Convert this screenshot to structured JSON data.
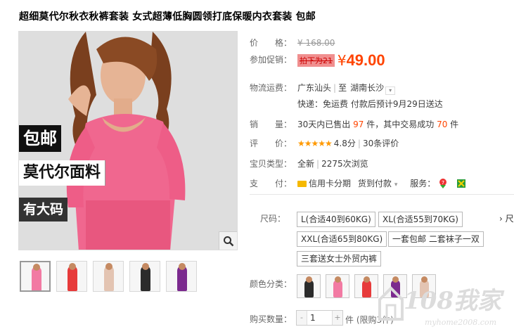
{
  "product": {
    "title": "超细莫代尔秋衣秋裤套装 女式超薄低胸圆领打底保暖内衣套装 包邮"
  },
  "gallery": {
    "promo_lines": [
      "包邮",
      "莫代尔面料",
      "有大码"
    ],
    "thumbnails": [
      {
        "color": "#f27aa3",
        "active": true
      },
      {
        "color": "#e73b3b",
        "active": false
      },
      {
        "color": "#e3c4b2",
        "active": false
      },
      {
        "color": "#2b2b2b",
        "active": false
      },
      {
        "color": "#7b2a8e",
        "active": false
      }
    ]
  },
  "price": {
    "label": "价　　格：",
    "original": "¥ 168.00",
    "promo_label": "参加促销：",
    "promo_tag": "拍下为21",
    "currency": "¥",
    "current": "49.00"
  },
  "shipping": {
    "label": "物流运费：",
    "from": "广东汕头",
    "to_prefix": "至",
    "to": "湖南长沙",
    "detail": "快递：免运费 付款后预计9月29日送达"
  },
  "sales": {
    "label": "销　　量：",
    "prefix": "30天内已售出",
    "sold": "97",
    "mid": "件，其中交易成功",
    "success": "70",
    "suffix": "件"
  },
  "rating": {
    "label": "评　　价：",
    "stars": "★★★★★",
    "score": "4.8分",
    "reviews": "30条评价"
  },
  "item_type": {
    "label": "宝贝类型：",
    "type": "全新",
    "views": "2275次浏览"
  },
  "payment": {
    "label": "支　　付：",
    "credit": "信用卡分期",
    "cod": "货到付款",
    "service_label": "服务："
  },
  "size": {
    "label": "尺码：",
    "options": [
      "L(合适40到60KG)",
      "XL(合适55到70KG)",
      "XXL(合适65到80KG)",
      "一套包邮 二套袜子一双",
      "三套送女士外贸内裤"
    ],
    "more": "尺"
  },
  "color": {
    "label": "颜色分类：",
    "swatches": [
      "#2b2b2b",
      "#f27aa3",
      "#e73b3b",
      "#7b2a8e",
      "#e3c4b2"
    ]
  },
  "quantity": {
    "label": "购买数量：",
    "value": "1",
    "minus": "-",
    "plus": "+",
    "unit": "件 (限购3件)"
  },
  "watermark": {
    "brand": "108我家",
    "url": "myhome2008.com"
  }
}
